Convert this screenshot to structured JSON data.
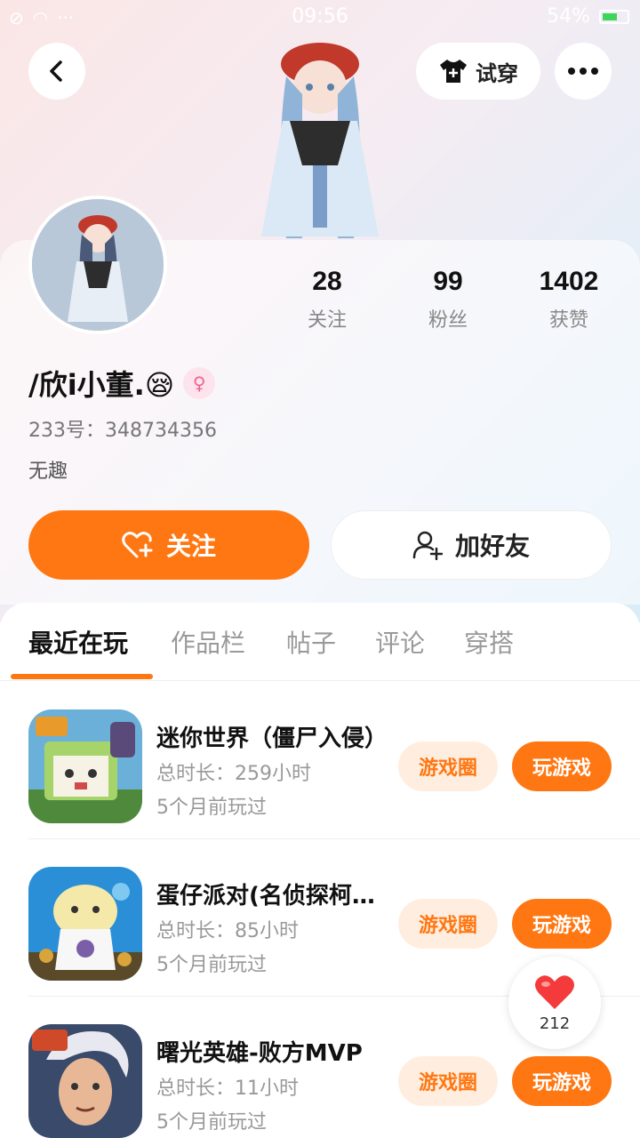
{
  "status_bar": {
    "time": "09:56",
    "battery": "54%"
  },
  "header": {
    "try_on_label": "试穿"
  },
  "stats": [
    {
      "num": "28",
      "label": "关注"
    },
    {
      "num": "99",
      "label": "粉丝"
    },
    {
      "num": "1402",
      "label": "获赞"
    }
  ],
  "profile": {
    "username": "/欣i小董.😪",
    "user_id": "233号：348734356",
    "bio": "无趣"
  },
  "actions": {
    "follow_label": "关注",
    "add_friend_label": "加好友"
  },
  "tabs": [
    "最近在玩",
    "作品栏",
    "帖子",
    "评论",
    "穿搭"
  ],
  "games": [
    {
      "title": "迷你世界（僵尸入侵）",
      "time": "总时长：259小时",
      "last": "5个月前玩过",
      "circle_label": "游戏圈",
      "play_label": "玩游戏"
    },
    {
      "title": "蛋仔派对(名侦探柯南联动)",
      "time": "总时长：85小时",
      "last": "5个月前玩过",
      "circle_label": "游戏圈",
      "play_label": "玩游戏"
    },
    {
      "title": "曙光英雄-败方MVP",
      "time": "总时长：11小时",
      "last": "5个月前玩过",
      "circle_label": "游戏圈",
      "play_label": "玩游戏"
    }
  ],
  "like": {
    "count": "212"
  },
  "colors": {
    "accent": "#ff7712",
    "accent_light": "#ffeee0"
  }
}
